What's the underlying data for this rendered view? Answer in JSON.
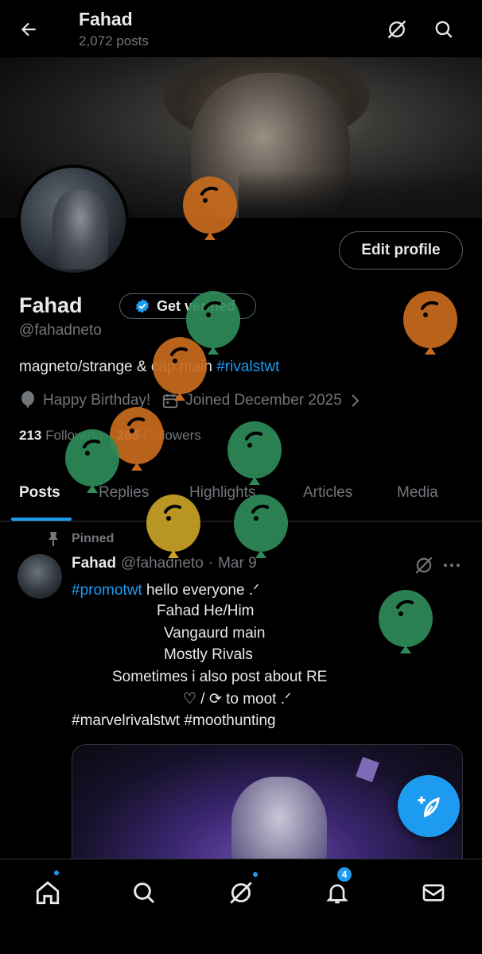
{
  "header": {
    "title": "Fahad",
    "subtitle": "2,072 posts",
    "back_icon": "arrow-left-icon",
    "grok_icon": "slash-circle-icon",
    "search_icon": "search-icon"
  },
  "profile": {
    "edit_profile_label": "Edit profile",
    "display_name": "Fahad",
    "get_verified_label": "Get verified",
    "handle": "@fahadneto",
    "bio_text": "magneto/strange & cap main ",
    "bio_hashtag": "#rivalstwt",
    "birthday": "Happy Birthday!",
    "joined": "Joined December 2025",
    "following_count": "213",
    "following_label": "Following",
    "followers_count": "265",
    "followers_label": "Followers"
  },
  "tabs": [
    {
      "label": "Posts"
    },
    {
      "label": "Replies"
    },
    {
      "label": "Highlights"
    },
    {
      "label": "Articles"
    },
    {
      "label": "Media"
    }
  ],
  "post": {
    "pinned_label": "Pinned",
    "author": "Fahad",
    "handle": "@fahadneto",
    "separator": "·",
    "date": "Mar 9",
    "line1_hashtag": "#promotwt",
    "line1_text": " hello everyone .ᐟ",
    "line2": "Fahad  He/Him",
    "line3": "Vangaurd main",
    "line4": "Mostly Rivals",
    "line5": "Sometimes i also post about RE",
    "line6": "♡ / ⟳ to moot .ᐟ",
    "line7": "#marvelrivalstwt #moothunting",
    "more_icon": "ellipsis-icon"
  },
  "bottom_nav": {
    "notifications_badge": "4"
  },
  "colors": {
    "accent": "#1d9bf0",
    "balloon_orange": "#c86a1e",
    "balloon_green": "#2e8b57",
    "balloon_yellow": "#c9a227"
  }
}
